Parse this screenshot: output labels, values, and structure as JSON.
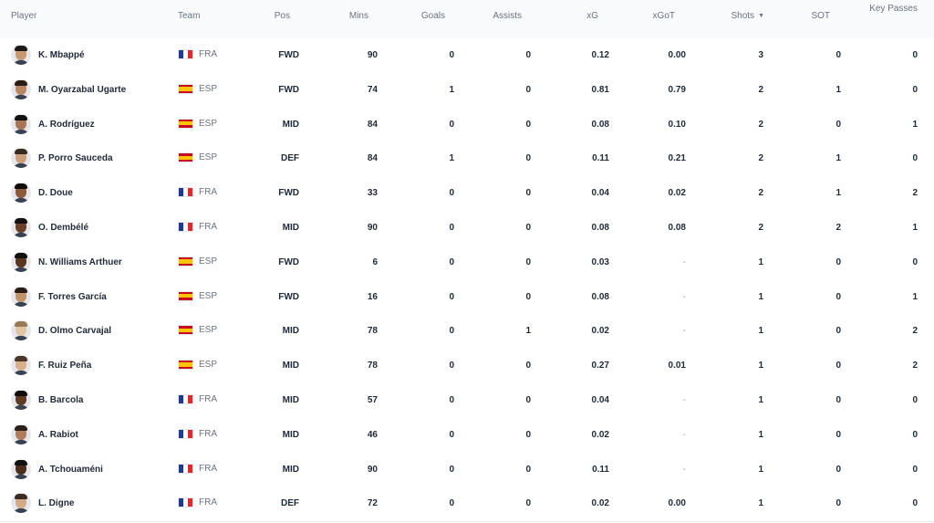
{
  "headers": {
    "player": "Player",
    "team": "Team",
    "pos": "Pos",
    "mins": "Mins",
    "goals": "Goals",
    "assists": "Assists",
    "xg": "xG",
    "xgot": "xGoT",
    "shots": "Shots",
    "sot": "SOT",
    "key_passes": "Key Passes"
  },
  "icons": {
    "sort": "sort-desc-icon",
    "flag_fra": "flag-france-icon",
    "flag_esp": "flag-spain-icon"
  },
  "rows": [
    {
      "player": "K. Mbappé",
      "team": "FRA",
      "pos": "FWD",
      "mins": "90",
      "goals": "0",
      "assists": "0",
      "xg": "0.12",
      "xgot": "0.00",
      "shots": "3",
      "sot": "0",
      "key_passes": "0"
    },
    {
      "player": "M. Oyarzabal Ugarte",
      "team": "ESP",
      "pos": "FWD",
      "mins": "74",
      "goals": "1",
      "assists": "0",
      "xg": "0.81",
      "xgot": "0.79",
      "shots": "2",
      "sot": "1",
      "key_passes": "0"
    },
    {
      "player": "A. Rodríguez",
      "team": "ESP",
      "pos": "MID",
      "mins": "84",
      "goals": "0",
      "assists": "0",
      "xg": "0.08",
      "xgot": "0.10",
      "shots": "2",
      "sot": "0",
      "key_passes": "1"
    },
    {
      "player": "P. Porro Sauceda",
      "team": "ESP",
      "pos": "DEF",
      "mins": "84",
      "goals": "1",
      "assists": "0",
      "xg": "0.11",
      "xgot": "0.21",
      "shots": "2",
      "sot": "1",
      "key_passes": "0"
    },
    {
      "player": "D. Doue",
      "team": "FRA",
      "pos": "FWD",
      "mins": "33",
      "goals": "0",
      "assists": "0",
      "xg": "0.04",
      "xgot": "0.02",
      "shots": "2",
      "sot": "1",
      "key_passes": "2"
    },
    {
      "player": "O. Dembélé",
      "team": "FRA",
      "pos": "MID",
      "mins": "90",
      "goals": "0",
      "assists": "0",
      "xg": "0.08",
      "xgot": "0.08",
      "shots": "2",
      "sot": "2",
      "key_passes": "1"
    },
    {
      "player": "N. Williams Arthuer",
      "team": "ESP",
      "pos": "FWD",
      "mins": "6",
      "goals": "0",
      "assists": "0",
      "xg": "0.03",
      "xgot": "-",
      "shots": "1",
      "sot": "0",
      "key_passes": "0"
    },
    {
      "player": "F. Torres García",
      "team": "ESP",
      "pos": "FWD",
      "mins": "16",
      "goals": "0",
      "assists": "0",
      "xg": "0.08",
      "xgot": "-",
      "shots": "1",
      "sot": "0",
      "key_passes": "1"
    },
    {
      "player": "D. Olmo Carvajal",
      "team": "ESP",
      "pos": "MID",
      "mins": "78",
      "goals": "0",
      "assists": "1",
      "xg": "0.02",
      "xgot": "-",
      "shots": "1",
      "sot": "0",
      "key_passes": "2"
    },
    {
      "player": "F. Ruiz Peña",
      "team": "ESP",
      "pos": "MID",
      "mins": "78",
      "goals": "0",
      "assists": "0",
      "xg": "0.27",
      "xgot": "0.01",
      "shots": "1",
      "sot": "0",
      "key_passes": "2"
    },
    {
      "player": "B. Barcola",
      "team": "FRA",
      "pos": "MID",
      "mins": "57",
      "goals": "0",
      "assists": "0",
      "xg": "0.04",
      "xgot": "-",
      "shots": "1",
      "sot": "0",
      "key_passes": "0"
    },
    {
      "player": "A. Rabiot",
      "team": "FRA",
      "pos": "MID",
      "mins": "46",
      "goals": "0",
      "assists": "0",
      "xg": "0.02",
      "xgot": "-",
      "shots": "1",
      "sot": "0",
      "key_passes": "0"
    },
    {
      "player": "A. Tchouaméni",
      "team": "FRA",
      "pos": "MID",
      "mins": "90",
      "goals": "0",
      "assists": "0",
      "xg": "0.11",
      "xgot": "-",
      "shots": "1",
      "sot": "0",
      "key_passes": "0"
    },
    {
      "player": "L. Digne",
      "team": "FRA",
      "pos": "DEF",
      "mins": "72",
      "goals": "0",
      "assists": "0",
      "xg": "0.02",
      "xgot": "0.00",
      "shots": "1",
      "sot": "0",
      "key_passes": "0"
    }
  ]
}
